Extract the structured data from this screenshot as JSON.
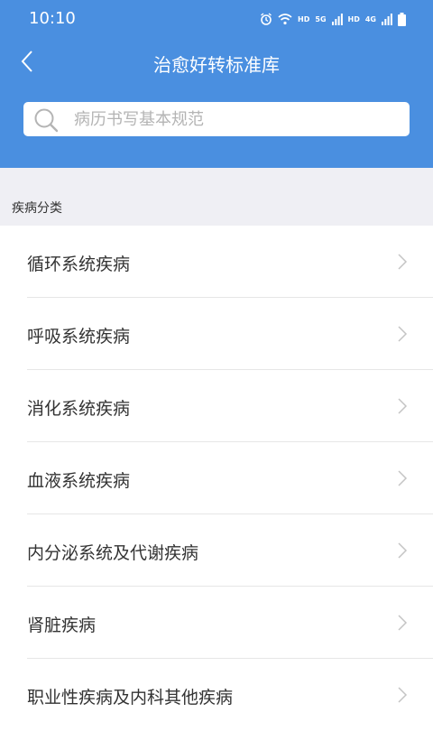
{
  "status_bar": {
    "time": "10:10",
    "hd1": "HD",
    "net1": "5G",
    "hd2": "HD",
    "net2": "4G"
  },
  "nav": {
    "title": "治愈好转标准库"
  },
  "search": {
    "placeholder": "病历书写基本规范"
  },
  "section": {
    "label": "疾病分类"
  },
  "categories": [
    {
      "label": "循环系统疾病"
    },
    {
      "label": "呼吸系统疾病"
    },
    {
      "label": "消化系统疾病"
    },
    {
      "label": "血液系统疾病"
    },
    {
      "label": "内分泌系统及代谢疾病"
    },
    {
      "label": "肾脏疾病"
    },
    {
      "label": "职业性疾病及内科其他疾病"
    }
  ],
  "colors": {
    "header": "#4a8fe0",
    "background": "#efeff4"
  },
  "icons": {
    "back": "chevron-left-icon",
    "search": "search-icon",
    "row": "chevron-right-icon"
  }
}
